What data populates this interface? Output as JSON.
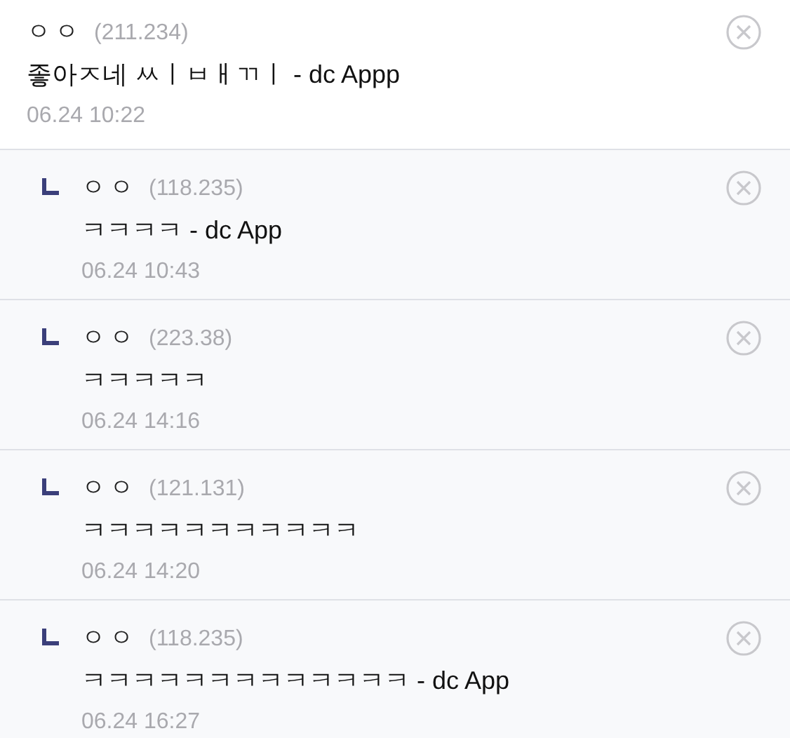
{
  "comments": [
    {
      "kind": "comment",
      "author": "ㅇㅇ",
      "ip": "(211.234)",
      "text": "좋아ㅈ네 ㅆㅣㅂㅐㄲㅣ - dc Appp",
      "time": "06.24 10:22"
    },
    {
      "kind": "reply",
      "author": "ㅇㅇ",
      "ip": "(118.235)",
      "text": "ㅋㅋㅋㅋ - dc App",
      "time": "06.24 10:43"
    },
    {
      "kind": "reply",
      "author": "ㅇㅇ",
      "ip": "(223.38)",
      "text": "ㅋㅋㅋㅋㅋ",
      "time": "06.24 14:16"
    },
    {
      "kind": "reply",
      "author": "ㅇㅇ",
      "ip": "(121.131)",
      "text": "ㅋㅋㅋㅋㅋㅋㅋㅋㅋㅋㅋ",
      "time": "06.24 14:20"
    },
    {
      "kind": "reply",
      "author": "ㅇㅇ",
      "ip": "(118.235)",
      "text": "ㅋㅋㅋㅋㅋㅋㅋㅋㅋㅋㅋㅋㅋ - dc App",
      "time": "06.24 16:27"
    }
  ]
}
